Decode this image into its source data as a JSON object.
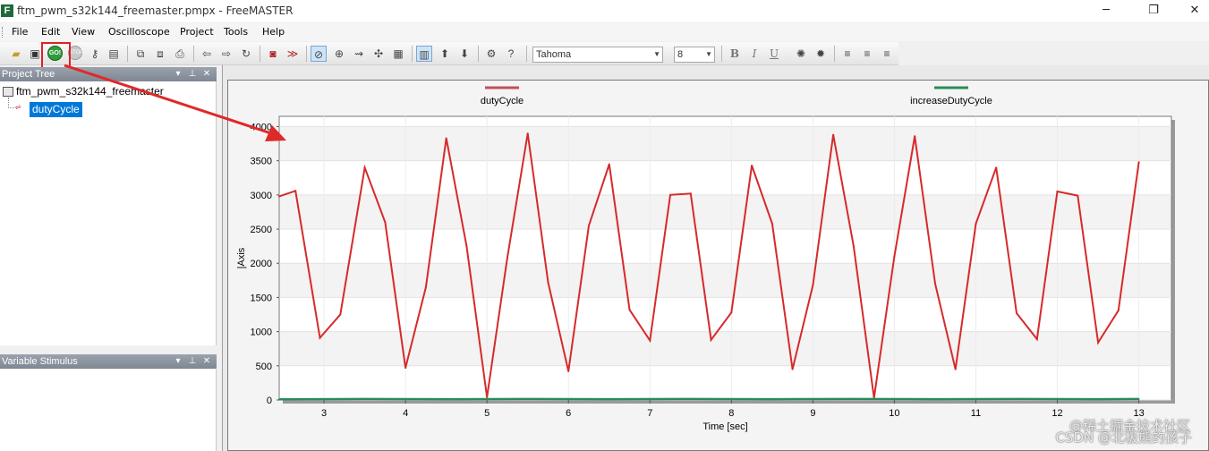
{
  "window": {
    "title": "ftm_pwm_s32k144_freemaster.pmpx - FreeMASTER",
    "app_icon_letter": "F",
    "minimize_glyph": "─",
    "maximize_glyph": "❐",
    "close_glyph": "✕"
  },
  "menu": {
    "items": [
      "File",
      "Edit",
      "View",
      "Oscilloscope",
      "Project",
      "Tools",
      "Help"
    ]
  },
  "toolbar": {
    "go_label": "GO!",
    "stop_label": "STOP",
    "font_name": "Tahoma",
    "font_size": "8",
    "bold_label": "B",
    "italic_label": "I",
    "underline_label": "U",
    "icons": [
      "open-folder-icon",
      "save-icon",
      "go-icon",
      "stop-icon",
      "key-icon",
      "properties-icon",
      "copy-icon",
      "paste-icon",
      "print-icon",
      "back-arrow-icon",
      "forward-arrow-icon",
      "refresh-icon",
      "record-icon",
      "waveform-icon",
      "zoom-icon",
      "zoom-in-icon",
      "pan-icon",
      "fit-icon",
      "clipboard-icon",
      "grid-icon",
      "up-arrow-icon",
      "down-arrow-icon",
      "settings-icon",
      "help-icon"
    ],
    "highlight_color": "#e02020"
  },
  "project_tree": {
    "header": "Project Tree",
    "root": "ftm_pwm_s32k144_freemaster",
    "selected_item": "dutyCycle"
  },
  "variable_stimulus": {
    "header": "Variable Stimulus"
  },
  "panel_controls": {
    "dropdown": "▾",
    "pin": "⊥",
    "close": "✕"
  },
  "watermark": {
    "line1": "@稀土掘金技术社区",
    "line2": "CSDN @北极熊的孩子"
  },
  "chart_data": {
    "type": "line",
    "title": "",
    "xlabel": "Time [sec]",
    "ylabel": "|Axis",
    "xlim": [
      2.45,
      13.4
    ],
    "ylim": [
      0,
      4150
    ],
    "xticks": [
      "3",
      "4",
      "5",
      "6",
      "7",
      "8",
      "9",
      "10",
      "11",
      "12",
      "13"
    ],
    "yticks": [
      "0",
      "500",
      "1000",
      "1500",
      "2000",
      "2500",
      "3000",
      "3500",
      "4000"
    ],
    "grid": true,
    "legend_placement": "top",
    "series": [
      {
        "name": "dutyCycle",
        "color": "#d62a2a",
        "legend_color": "#c0505a",
        "x": [
          2.45,
          2.65,
          2.95,
          3.2,
          3.5,
          3.75,
          4.0,
          4.25,
          4.5,
          4.75,
          5.0,
          5.25,
          5.5,
          5.75,
          6.0,
          6.25,
          6.5,
          6.75,
          7.0,
          7.25,
          7.5,
          7.75,
          8.0,
          8.25,
          8.5,
          8.75,
          9.0,
          9.25,
          9.5,
          9.75,
          10.0,
          10.25,
          10.5,
          10.75,
          11.0,
          11.25,
          11.5,
          11.75,
          12.0,
          12.25,
          12.5,
          12.75,
          13.0
        ],
        "values": [
          2980,
          3060,
          910,
          1250,
          3400,
          2600,
          470,
          1650,
          3830,
          2250,
          40,
          2080,
          3900,
          1720,
          420,
          2550,
          3450,
          1320,
          870,
          3000,
          3020,
          880,
          1280,
          3430,
          2580,
          450,
          1680,
          3880,
          2250,
          30,
          2100,
          3860,
          1700,
          450,
          2580,
          3400,
          1270,
          890,
          3050,
          2990,
          840,
          1310,
          3480
        ]
      },
      {
        "name": "increaseDutyCycle",
        "color": "#2a8a5a",
        "legend_color": "#2a8a5a",
        "x": [
          2.45,
          3.5,
          4.5,
          5.5,
          6.5,
          7.5,
          8.5,
          9.5,
          10.5,
          11.5,
          12.5,
          13.0
        ],
        "values": [
          10,
          15,
          12,
          15,
          12,
          15,
          12,
          15,
          12,
          15,
          12,
          15
        ]
      }
    ]
  }
}
